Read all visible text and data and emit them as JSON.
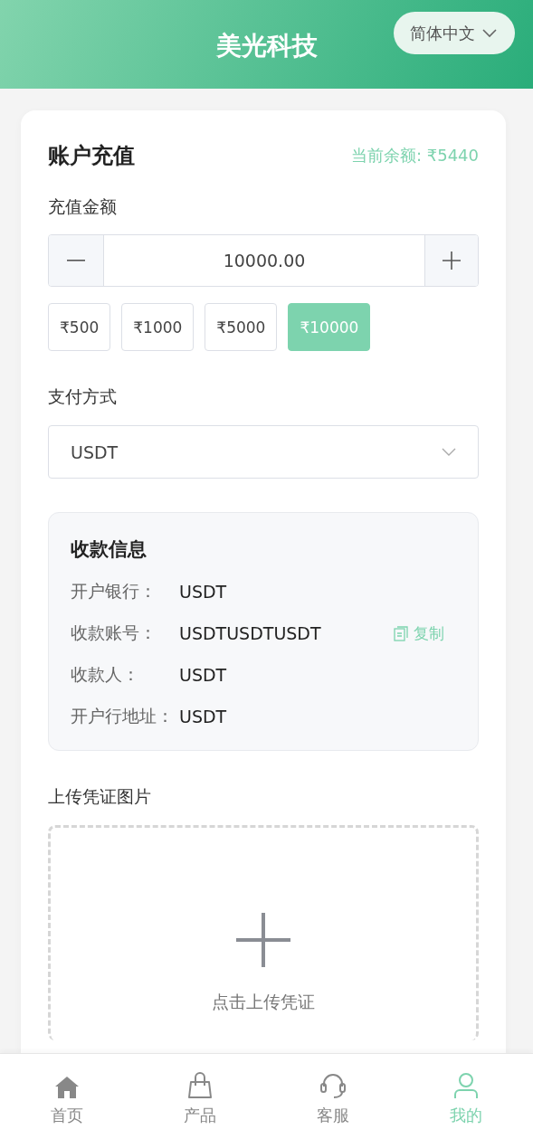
{
  "header": {
    "title": "美光科技",
    "language": "简体中文"
  },
  "recharge": {
    "title": "账户充值",
    "balance": "当前余额: ₹5440",
    "amount_label": "充值金额",
    "amount_value": "10000.00",
    "presets": [
      {
        "label": "₹500",
        "selected": false
      },
      {
        "label": "₹1000",
        "selected": false
      },
      {
        "label": "₹5000",
        "selected": false
      },
      {
        "label": "₹10000",
        "selected": true
      }
    ],
    "payment_label": "支付方式",
    "payment_value": "USDT",
    "receipt": {
      "title": "收款信息",
      "rows": [
        {
          "label": "开户银行：",
          "value": "USDT"
        },
        {
          "label": "收款账号：",
          "value": "USDTUSDTUSDT",
          "action": "复制"
        },
        {
          "label": "收款人：",
          "value": "USDT"
        },
        {
          "label": "开户行地址：",
          "value": "USDT"
        }
      ]
    },
    "upload_label": "上传凭证图片",
    "upload_hint": "点击上传凭证"
  },
  "nav": [
    {
      "label": "首页",
      "selected": false
    },
    {
      "label": "产品",
      "selected": false
    },
    {
      "label": "客服",
      "selected": false
    },
    {
      "label": "我的",
      "selected": true
    }
  ]
}
